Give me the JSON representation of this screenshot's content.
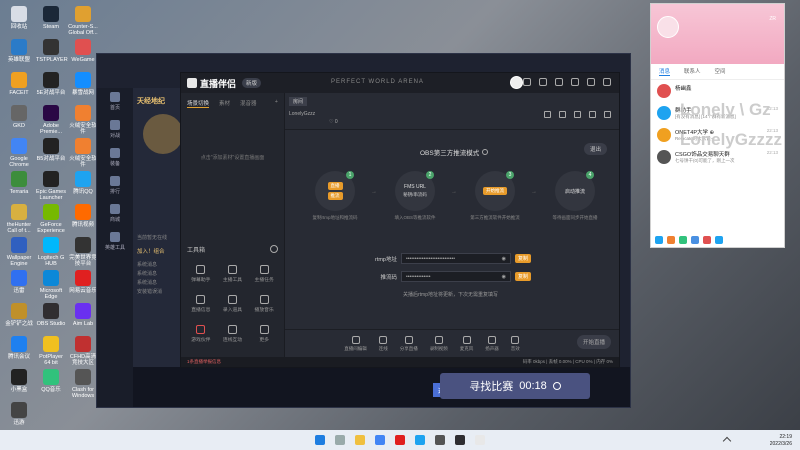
{
  "desktop_icons": [
    {
      "label": "回收站",
      "color": "#d8dde6"
    },
    {
      "label": "Steam",
      "color": "#1b2838"
    },
    {
      "label": "Counter-S... Global Off...",
      "color": "#e0a030"
    },
    {
      "label": "英雄联盟",
      "color": "#2b7bc8"
    },
    {
      "label": "TSTPLAYER",
      "color": "#333"
    },
    {
      "label": "WeGame",
      "color": "#e05050"
    },
    {
      "label": "FACEIT",
      "color": "#f0a020"
    },
    {
      "label": "5E对战平台",
      "color": "#222"
    },
    {
      "label": "暴雪战网",
      "color": "#148eff"
    },
    {
      "label": "GKD",
      "color": "#666"
    },
    {
      "label": "Adobe Premie...",
      "color": "#2a0845"
    },
    {
      "label": "火绒安全软件",
      "color": "#f08030"
    },
    {
      "label": "Google Chrome",
      "color": "#4285f4"
    },
    {
      "label": "B5对战平台",
      "color": "#222"
    },
    {
      "label": "火绒安全软件",
      "color": "#f08030"
    },
    {
      "label": "Terraria",
      "color": "#3c8d3c"
    },
    {
      "label": "Epic Games Launcher",
      "color": "#222"
    },
    {
      "label": "腾讯QQ",
      "color": "#1ea3f0"
    },
    {
      "label": "theHunter Call of t...",
      "color": "#d8b040"
    },
    {
      "label": "GeForce Experience",
      "color": "#76b900"
    },
    {
      "label": "腾讯视频",
      "color": "#ff6a00"
    },
    {
      "label": "Wallpaper Engine",
      "color": "#3060c0"
    },
    {
      "label": "Logitech G HUB",
      "color": "#00b8fc"
    },
    {
      "label": "完美世界竞技平台",
      "color": "#333"
    },
    {
      "label": "迅雷",
      "color": "#3070f0"
    },
    {
      "label": "Microsoft Edge",
      "color": "#0c88d8"
    },
    {
      "label": "网易云音乐",
      "color": "#e02020"
    },
    {
      "label": "金铲铲之战",
      "color": "#c0902a"
    },
    {
      "label": "OBS Studio",
      "color": "#302e31"
    },
    {
      "label": "Aim Lab",
      "color": "#6a30f0"
    },
    {
      "label": "腾讯会议",
      "color": "#1e80f0"
    },
    {
      "label": "PotPlayer 64 bit",
      "color": "#f0c020"
    },
    {
      "label": "CFHD高清竞技大区",
      "color": "#c03030"
    },
    {
      "label": "小黑盒",
      "color": "#222"
    },
    {
      "label": "QQ音乐",
      "color": "#31c27c"
    },
    {
      "label": "Clash for Windows",
      "color": "#555"
    },
    {
      "label": "迅游",
      "color": "#444"
    }
  ],
  "game_window": {
    "left_banner": "天经地纪",
    "nav_items": [
      "首页",
      "对战",
      "装备",
      "排行",
      "商城",
      "英雄工具"
    ],
    "friend_hint": "当前暂无在线",
    "add_label": "加入！组合",
    "sys_messages": [
      "系统消息",
      "系统消息",
      "系统消息",
      "安装错误消"
    ],
    "invite_label": "邀请",
    "find_match_label": "寻找比赛",
    "timer": "00:18"
  },
  "app": {
    "logo_text": "直播伴侣",
    "version_badge": "新版",
    "window_title": "PERFECT WORLD ARENA",
    "left_tabs": [
      "场景切换",
      "素材",
      "混音器"
    ],
    "left_empty_text": "点击\"添加素材\"设置直播画面",
    "tools_title": "工具箱",
    "tools": [
      {
        "label": "弹幕助手",
        "hl": false
      },
      {
        "label": "主播工具",
        "hl": false
      },
      {
        "label": "主播任务",
        "hl": false
      },
      {
        "label": "直播信息",
        "hl": false
      },
      {
        "label": "录入道具",
        "hl": false
      },
      {
        "label": "播放音乐",
        "hl": false
      },
      {
        "label": "游戏伙伴",
        "hl": true
      },
      {
        "label": "连线互动",
        "hl": false
      },
      {
        "label": "更多",
        "hl": false
      }
    ],
    "room_tag": "房间",
    "room_name": "LonelyGzzz",
    "likes": "0",
    "obs_mode_title": "OBS第三方推流模式",
    "exit_label": "退出",
    "steps": [
      {
        "num": "1",
        "pill1": "直播",
        "pill2": "推流",
        "desc": "复制rtmp地址和推流码"
      },
      {
        "num": "2",
        "txt": "FMS URL",
        "sub": "秘钥/串流码",
        "desc": "填入OBS等推流软件"
      },
      {
        "num": "3",
        "pill1": "开始推流",
        "desc": "第三方推流软件开始推流"
      },
      {
        "num": "4",
        "txt": "启动推流",
        "desc": "等待画面同步开始直播"
      }
    ],
    "rtmp_label": "rtmp地址",
    "rtmp_value": "••••••••••••••••••••••••••••",
    "key_label": "推流码",
    "key_value": "••••••••••••••",
    "copy_label": "复制",
    "warn_text": "关播后rtmp地址将更新，下次无需重复填写",
    "bottom_tools": [
      "直播间编辑",
      "连线",
      "分享直播",
      "录制视频",
      "麦克风",
      "扬声器",
      "音效"
    ],
    "start_label": "开始直播",
    "status_left": "1条直播举报信息",
    "status_right": "码率 0kbps | 丢帧 0.00% | CPU 0% | 内存 0%"
  },
  "chat": {
    "tabs": [
      "消息",
      "联系人",
      "空间"
    ],
    "header_name": "ZR",
    "items": [
      {
        "name": "杨幽鑫",
        "msg": "",
        "time": ""
      },
      {
        "name": "群助手",
        "msg": "[有没有消息] [14个群有新消息]",
        "time": "22:13"
      },
      {
        "name": "ONET4P大学 ⊕",
        "msg": "Relocate对大家说~",
        "time": "22:13"
      },
      {
        "name": "CSGO饰品交易聊天群",
        "msg": "七号饼干(0)可能了，刚上一次",
        "time": "22:13"
      }
    ],
    "overlay_top": "Lonely \\ Gz",
    "overlay_bottom": "LonelyGzzzz"
  },
  "taskbar": {
    "time": "22:19",
    "date": "2022/3/26"
  }
}
